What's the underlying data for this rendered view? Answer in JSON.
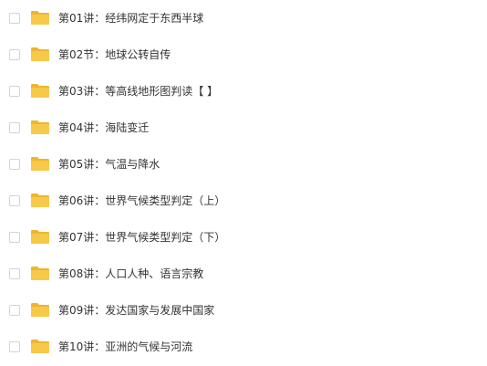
{
  "colors": {
    "folder_body": "#f7c948",
    "folder_tab": "#eeb52f",
    "checkbox_border": "#d4d4d4",
    "text": "#333333"
  },
  "folders": [
    {
      "name": "第01讲：经纬网定于东西半球",
      "icon": "folder-icon"
    },
    {
      "name": "第02节：地球公转自传",
      "icon": "folder-icon"
    },
    {
      "name": "第03讲：等高线地形图判读【 】",
      "icon": "folder-icon"
    },
    {
      "name": "第04讲：海陆变迁",
      "icon": "folder-icon"
    },
    {
      "name": "第05讲：气温与降水",
      "icon": "folder-icon"
    },
    {
      "name": "第06讲：世界气候类型判定（上）",
      "icon": "folder-icon"
    },
    {
      "name": "第07讲：世界气候类型判定（下）",
      "icon": "folder-icon"
    },
    {
      "name": "第08讲：人口人种、语言宗教",
      "icon": "folder-icon"
    },
    {
      "name": "第09讲：发达国家与发展中国家",
      "icon": "folder-icon"
    },
    {
      "name": "第10讲：亚洲的气候与河流",
      "icon": "folder-icon"
    }
  ]
}
